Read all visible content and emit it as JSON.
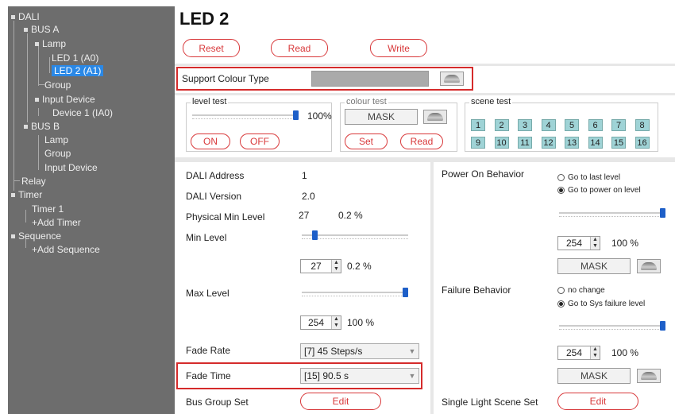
{
  "tree": {
    "dali": "DALI",
    "bus_a": "BUS A",
    "lamp_a": "Lamp",
    "led1": "LED 1 (A0)",
    "led2": "LED 2 (A1)",
    "group_a": "Group",
    "input_device_a": "Input Device",
    "device1": "Device 1 (IA0)",
    "bus_b": "BUS B",
    "lamp_b": "Lamp",
    "group_b": "Group",
    "input_device_b": "Input Device",
    "relay": "Relay",
    "timer": "Timer",
    "timer1": "Timer 1",
    "add_timer": "+Add Timer",
    "sequence": "Sequence",
    "add_sequence": "+Add Sequence"
  },
  "header": {
    "title": "LED 2",
    "reset": "Reset",
    "read": "Read",
    "write": "Write"
  },
  "support_colour": {
    "label": "Support Colour Type",
    "value": ""
  },
  "level_test": {
    "label": "level test",
    "percent": "100%",
    "level_fraction": 1.0,
    "on": "ON",
    "off": "OFF"
  },
  "colour_test": {
    "label": "colour test",
    "mask": "MASK",
    "set": "Set",
    "read": "Read"
  },
  "scene_test": {
    "label": "scene test",
    "scenes": [
      "1",
      "2",
      "3",
      "4",
      "5",
      "6",
      "7",
      "8",
      "9",
      "10",
      "11",
      "12",
      "13",
      "14",
      "15",
      "16"
    ]
  },
  "props": {
    "dali_address_label": "DALI Address",
    "dali_address": "1",
    "dali_version_label": "DALI Version",
    "dali_version": "2.0",
    "phys_min_label": "Physical Min Level",
    "phys_min_value": "27",
    "phys_min_percent": "0.2 %",
    "min_level_label": "Min Level",
    "min_level_fraction": 0.1,
    "min_level_value": "27",
    "min_level_percent": "0.2 %",
    "max_level_label": "Max Level",
    "max_level_fraction": 1.0,
    "max_level_value": "254",
    "max_level_percent": "100 %",
    "fade_rate_label": "Fade Rate",
    "fade_rate": "[7] 45 Steps/s",
    "fade_time_label": "Fade Time",
    "fade_time": "[15] 90.5 s",
    "bus_group_label": "Bus Group Set",
    "edit": "Edit"
  },
  "power_on": {
    "label": "Power On Behavior",
    "opt1": "Go to last level",
    "opt2": "Go to power on level",
    "selected": 2,
    "level_fraction": 1.0,
    "value": "254",
    "percent": "100 %",
    "mask": "MASK"
  },
  "failure": {
    "label": "Failure Behavior",
    "opt1": "no change",
    "opt2": "Go to Sys failure level",
    "selected": 2,
    "level_fraction": 1.0,
    "value": "254",
    "percent": "100 %",
    "mask": "MASK"
  },
  "scene_set": {
    "label": "Single Light Scene Set",
    "edit": "Edit"
  },
  "colors": {
    "accent_red": "#d8383a",
    "selection_blue": "#2a88e6",
    "scene_teal": "#9fd3d6",
    "sidebar_grey": "#6d6d6d"
  }
}
